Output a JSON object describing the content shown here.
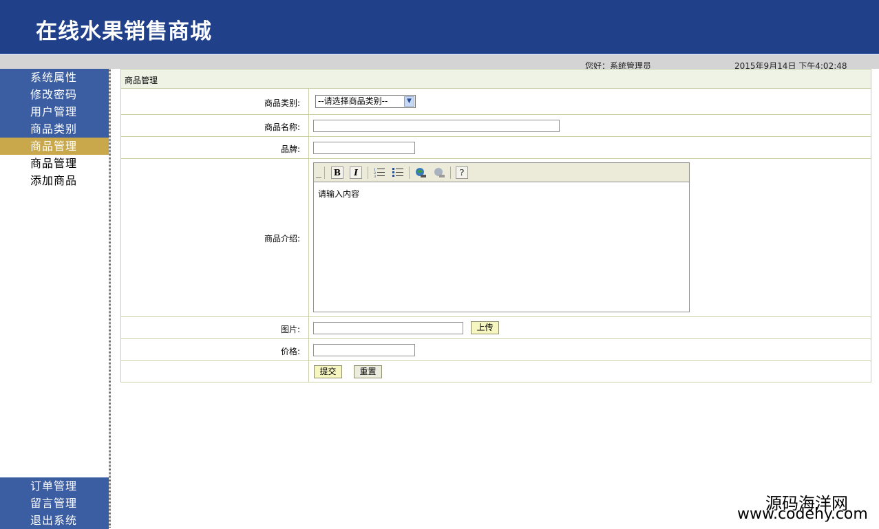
{
  "header": {
    "title": "在线水果销售商城",
    "greeting": "您好：系统管理员",
    "datetime": "2015年9月14日  下午4:02:48"
  },
  "sidebar": {
    "items": [
      {
        "label": "系统属性"
      },
      {
        "label": "修改密码"
      },
      {
        "label": "用户管理"
      },
      {
        "label": "商品类别"
      },
      {
        "label": "商品管理"
      },
      {
        "label": "商品管理"
      },
      {
        "label": "添加商品"
      }
    ],
    "bottom_items": [
      {
        "label": "订单管理"
      },
      {
        "label": "留言管理"
      },
      {
        "label": "退出系统"
      }
    ]
  },
  "form": {
    "title": "商品管理",
    "category_label": "商品类别:",
    "category_selected": "--请选择商品类别--",
    "name_label": "商品名称:",
    "name_value": "",
    "brand_label": "品牌:",
    "brand_value": "",
    "intro_label": "商品介绍:",
    "intro_placeholder": "请输入内容",
    "image_label": "图片:",
    "image_value": "",
    "upload_label": "上传",
    "price_label": "价格:",
    "price_value": "",
    "submit_label": "提交",
    "reset_label": "重置"
  },
  "editor_toolbar": {
    "bold": "B",
    "italic": "I",
    "help": "?"
  },
  "watermark": {
    "line1": "源码海洋网",
    "line2": "www.codehy.com"
  },
  "colors": {
    "header_bg": "#21408a",
    "nav_bg": "#3b5da1",
    "nav_active": "#c8a84a",
    "panel_border": "#c9cfa5",
    "panel_head_bg": "#eef3e6"
  }
}
